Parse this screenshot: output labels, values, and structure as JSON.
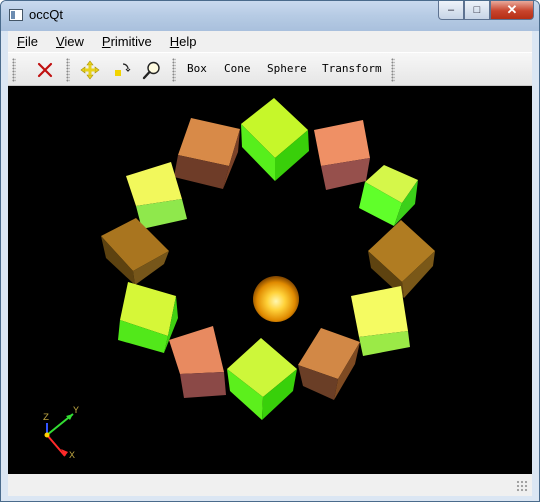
{
  "window": {
    "title": "occQt",
    "minimize_glyph": "–",
    "maximize_glyph": "□",
    "close_glyph": "✕"
  },
  "menubar": {
    "items": [
      {
        "label_first": "F",
        "label_rest": "ile"
      },
      {
        "label_first": "V",
        "label_rest": "iew"
      },
      {
        "label_first": "P",
        "label_rest": "rimitive"
      },
      {
        "label_first": "H",
        "label_rest": "elp"
      }
    ]
  },
  "toolbar": {
    "icons": [
      "close-icon",
      "pan-icon",
      "rotate-icon",
      "zoom-icon"
    ],
    "primitives": [
      "Box",
      "Cone",
      "Sphere",
      "Transform"
    ]
  },
  "viewport": {
    "background": "#000000",
    "axis_labels": {
      "z": "Z",
      "y": "Y",
      "x": "X"
    },
    "axis_colors": {
      "x": "#ff2a2a",
      "y": "#33dd33",
      "z": "#3355ff"
    }
  }
}
